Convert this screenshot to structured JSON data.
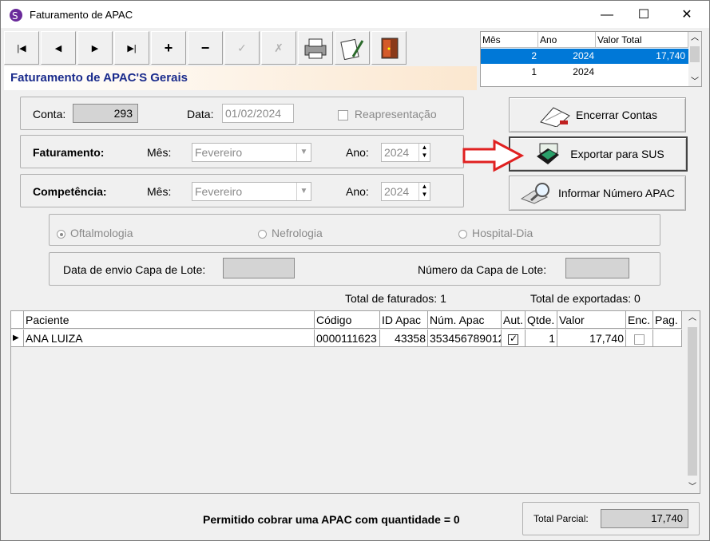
{
  "window": {
    "title": "Faturamento de APAC",
    "minimize": "—",
    "maximize": "☐",
    "close": "✕"
  },
  "toolbar": {
    "first": "|◀",
    "prior": "◀",
    "next": "▶",
    "last": "▶|",
    "insert": "+",
    "delete": "−",
    "post": "✓",
    "cancel": "✗"
  },
  "header": {
    "title": "Faturamento de APAC'S Gerais"
  },
  "periods_grid": {
    "columns": [
      "Mês",
      "Ano",
      "Valor Total"
    ],
    "rows": [
      {
        "mes": "2",
        "ano": "2024",
        "valor": "17,740"
      },
      {
        "mes": "1",
        "ano": "2024",
        "valor": ""
      }
    ]
  },
  "account": {
    "conta_label": "Conta:",
    "conta_value": "293",
    "data_label": "Data:",
    "data_value": "01/02/2024",
    "reapresentacao_label": "Reapresentação"
  },
  "faturamento": {
    "label": "Faturamento:",
    "mes_label": "Mês:",
    "mes_value": "Fevereiro",
    "ano_label": "Ano:",
    "ano_value": "2024"
  },
  "competencia": {
    "label": "Competência:",
    "mes_label": "Mês:",
    "mes_value": "Fevereiro",
    "ano_label": "Ano:",
    "ano_value": "2024"
  },
  "actions": {
    "encerrar": "Encerrar Contas",
    "exportar": "Exportar para SUS",
    "informar": "Informar Número APAC"
  },
  "specialties": {
    "oftalmologia": "Oftalmologia",
    "nefrologia": "Nefrologia",
    "hospital_dia": "Hospital-Dia"
  },
  "lote": {
    "data_envio_label": "Data de envio Capa de Lote:",
    "numero_label": "Número da Capa de Lote:"
  },
  "totals": {
    "faturados": "Total de faturados: 1",
    "exportadas": "Total de exportadas: 0"
  },
  "grid": {
    "columns": [
      "Paciente",
      "Código",
      "ID Apac",
      "Núm. Apac",
      "Aut.",
      "Qtde.",
      "Valor",
      "Enc.",
      "Pag."
    ],
    "rows": [
      {
        "paciente": "ANA LUIZA",
        "codigo": "0000111623",
        "id_apac": "43358",
        "num_apac": "353456789012",
        "aut": true,
        "qtde": "1",
        "valor": "17,740",
        "enc": false,
        "pag": ""
      }
    ]
  },
  "footer": {
    "message": "Permitido cobrar uma APAC com quantidade = 0",
    "total_parcial_label": "Total Parcial:",
    "total_parcial_value": "17,740"
  },
  "colors": {
    "accent_title": "#1a2b8c",
    "selection": "#0078d7",
    "annotation_arrow": "#e02020"
  }
}
